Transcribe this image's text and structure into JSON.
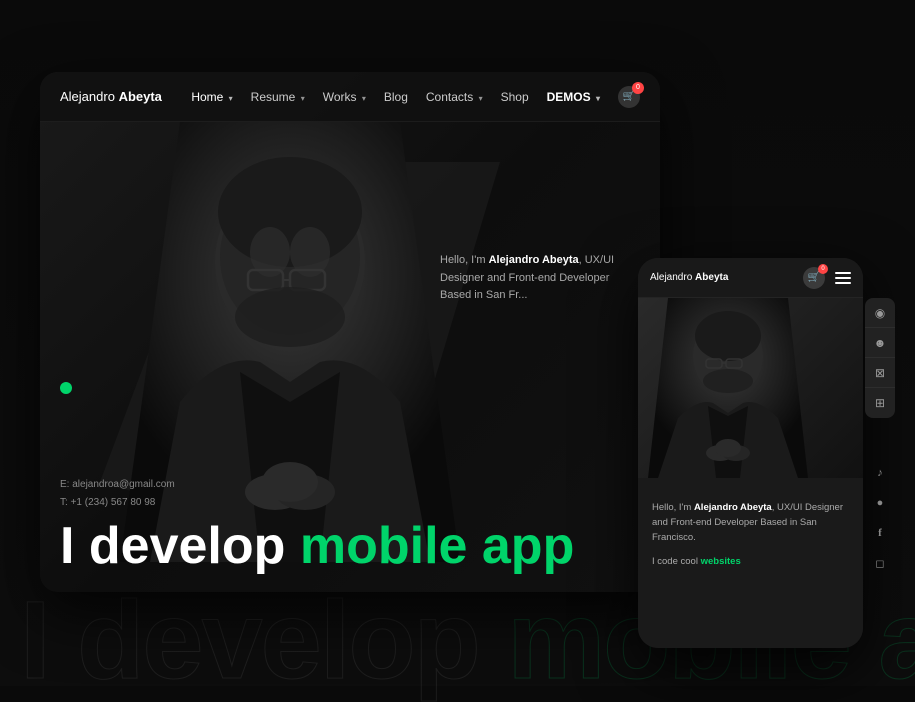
{
  "background": {
    "text1": "I develop",
    "text2": "mobile apps",
    "color_normal": "rgba(255,255,255,0.07)",
    "color_green": "rgba(0,212,106,0.2)"
  },
  "desktop": {
    "brand": {
      "first": "Alejandro",
      "last": "Abeyta"
    },
    "nav": {
      "items": [
        {
          "label": "Home",
          "active": true,
          "has_chevron": true
        },
        {
          "label": "Resume",
          "has_chevron": true
        },
        {
          "label": "Works",
          "has_chevron": true
        },
        {
          "label": "Blog"
        },
        {
          "label": "Contacts",
          "has_chevron": true
        },
        {
          "label": "Shop"
        },
        {
          "label": "DEMOS",
          "has_chevron": true
        }
      ],
      "cart_badge": "0"
    },
    "hero": {
      "hello_text": "Hello, I'm ",
      "name": "Alejandro Abeyta",
      "description": ", UX/UI Designer and Front-end Developer Based in San Fr...",
      "big_text_1": "I develop",
      "big_text_2": "mobile app",
      "contact_email_label": "E:",
      "contact_email": "alejandroa@gmail.com",
      "contact_phone_label": "T:",
      "contact_phone": "+1 (234) 567 80 98"
    }
  },
  "mobile": {
    "brand": {
      "first": "Alejandro",
      "last": "Abeyta"
    },
    "cart_badge": "0",
    "side_icons": [
      {
        "name": "eye-icon",
        "symbol": "◉"
      },
      {
        "name": "face-icon",
        "symbol": "☻"
      },
      {
        "name": "cart-icon",
        "symbol": "⊠"
      },
      {
        "name": "grid-icon",
        "symbol": "⊞"
      }
    ],
    "social_icons": [
      {
        "name": "tiktok-icon",
        "symbol": "♪"
      },
      {
        "name": "github-icon",
        "symbol": "●"
      },
      {
        "name": "facebook-icon",
        "symbol": "f"
      },
      {
        "name": "instagram-icon",
        "symbol": "◻"
      }
    ],
    "hello": {
      "text": "Hello, I'm ",
      "name": "Alejandro Abeyta",
      "description": ", UX/UI Designer and Front-end Developer Based in San Francisco."
    },
    "cta": {
      "text": "I code cool ",
      "highlight": "websites"
    }
  }
}
